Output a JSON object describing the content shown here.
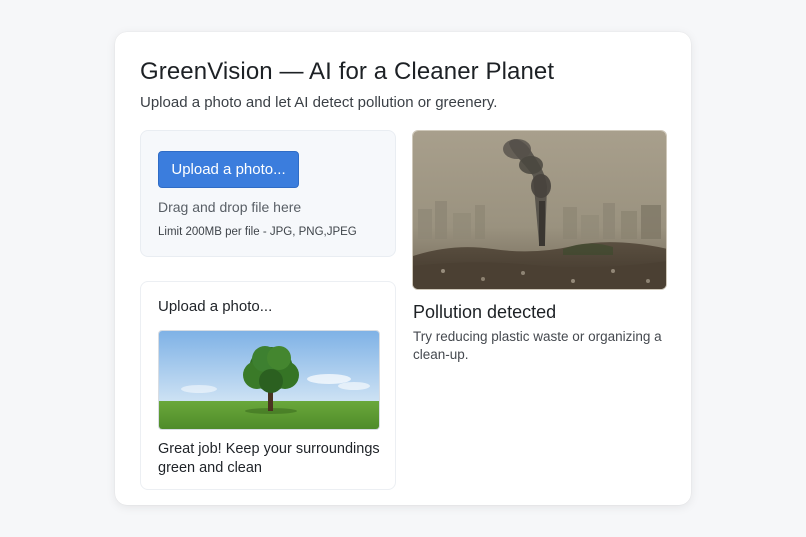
{
  "header": {
    "title": "GreenVision — AI for a Cleaner Planet",
    "subtitle": "Upload a photo and let AI detect pollution or greenery."
  },
  "uploader": {
    "button_label": "Upload a photo...",
    "drag_text": "Drag and drop file here",
    "limit_text": "Limit 200MB per file - JPG, PNG,JPEG"
  },
  "green_result": {
    "title": "Upload a photo...",
    "image_icon": "tree-photo",
    "message": "Great job! Keep your surroundings green and clean"
  },
  "pollution_result": {
    "image_icon": "smokestack-photo",
    "title": "Pollution detected",
    "tip": "Try reducing plastic waste or organizing a clean-up."
  },
  "colors": {
    "accent": "#3b7ddd",
    "background": "#f6f7f9",
    "card": "#ffffff"
  }
}
